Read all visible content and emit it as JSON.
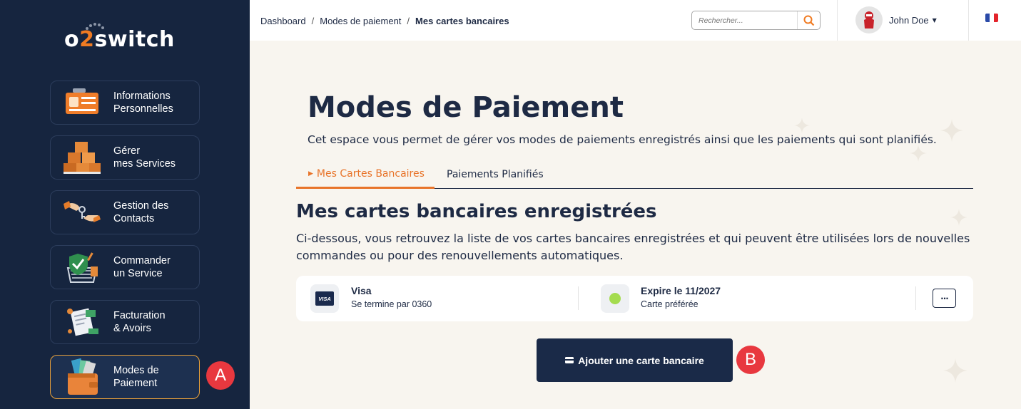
{
  "brand": {
    "logo_prefix": "o",
    "logo_two": "2",
    "logo_suffix": "switch"
  },
  "sidebar": {
    "items": [
      {
        "label": "Informations\nPersonnelles",
        "icon": "id-card-icon"
      },
      {
        "label": "Gérer\nmes Services",
        "icon": "boxes-icon"
      },
      {
        "label": "Gestion des\nContacts",
        "icon": "handshake-keys-icon"
      },
      {
        "label": "Commander\nun Service",
        "icon": "shield-basket-icon"
      },
      {
        "label": "Facturation\n& Avoirs",
        "icon": "invoice-icon"
      },
      {
        "label": "Modes de\nPaiement",
        "icon": "wallet-icon",
        "active": true
      }
    ]
  },
  "annotations": {
    "a": "A",
    "b": "B"
  },
  "topbar": {
    "breadcrumb": [
      "Dashboard",
      "Modes de paiement",
      "Mes cartes bancaires"
    ],
    "breadcrumb_sep": "/",
    "search_placeholder": "Rechercher...",
    "user_name": "John Doe",
    "language": "fr-flag-icon"
  },
  "main": {
    "title": "Modes de Paiement",
    "subtitle": "Cet espace vous permet de gérer vos modes de paiements enregistrés ainsi que les paiements qui sont planifiés.",
    "tabs": [
      {
        "label": "Mes Cartes Bancaires",
        "active": true
      },
      {
        "label": "Paiements Planifiés",
        "active": false
      }
    ],
    "section_title": "Mes cartes bancaires enregistrées",
    "section_desc": "Ci-dessous, vous retrouvez la liste de vos cartes bancaires enregistrées et qui peuvent être utilisées lors de nouvelles commandes ou pour des renouvellements automatiques.",
    "card": {
      "logo_text": "VISA",
      "brand": "Visa",
      "number_text": "Se termine par 0360",
      "expiry": "Expire le 11/2027",
      "status": "Carte préférée",
      "more_label": "···"
    },
    "add_button": "Ajouter une carte bancaire"
  },
  "colors": {
    "sidebar_bg": "#16253f",
    "accent": "#e8742a",
    "button_bg": "#1a2a48",
    "badge": "#e8383f",
    "status_green": "#a4dc4f"
  }
}
